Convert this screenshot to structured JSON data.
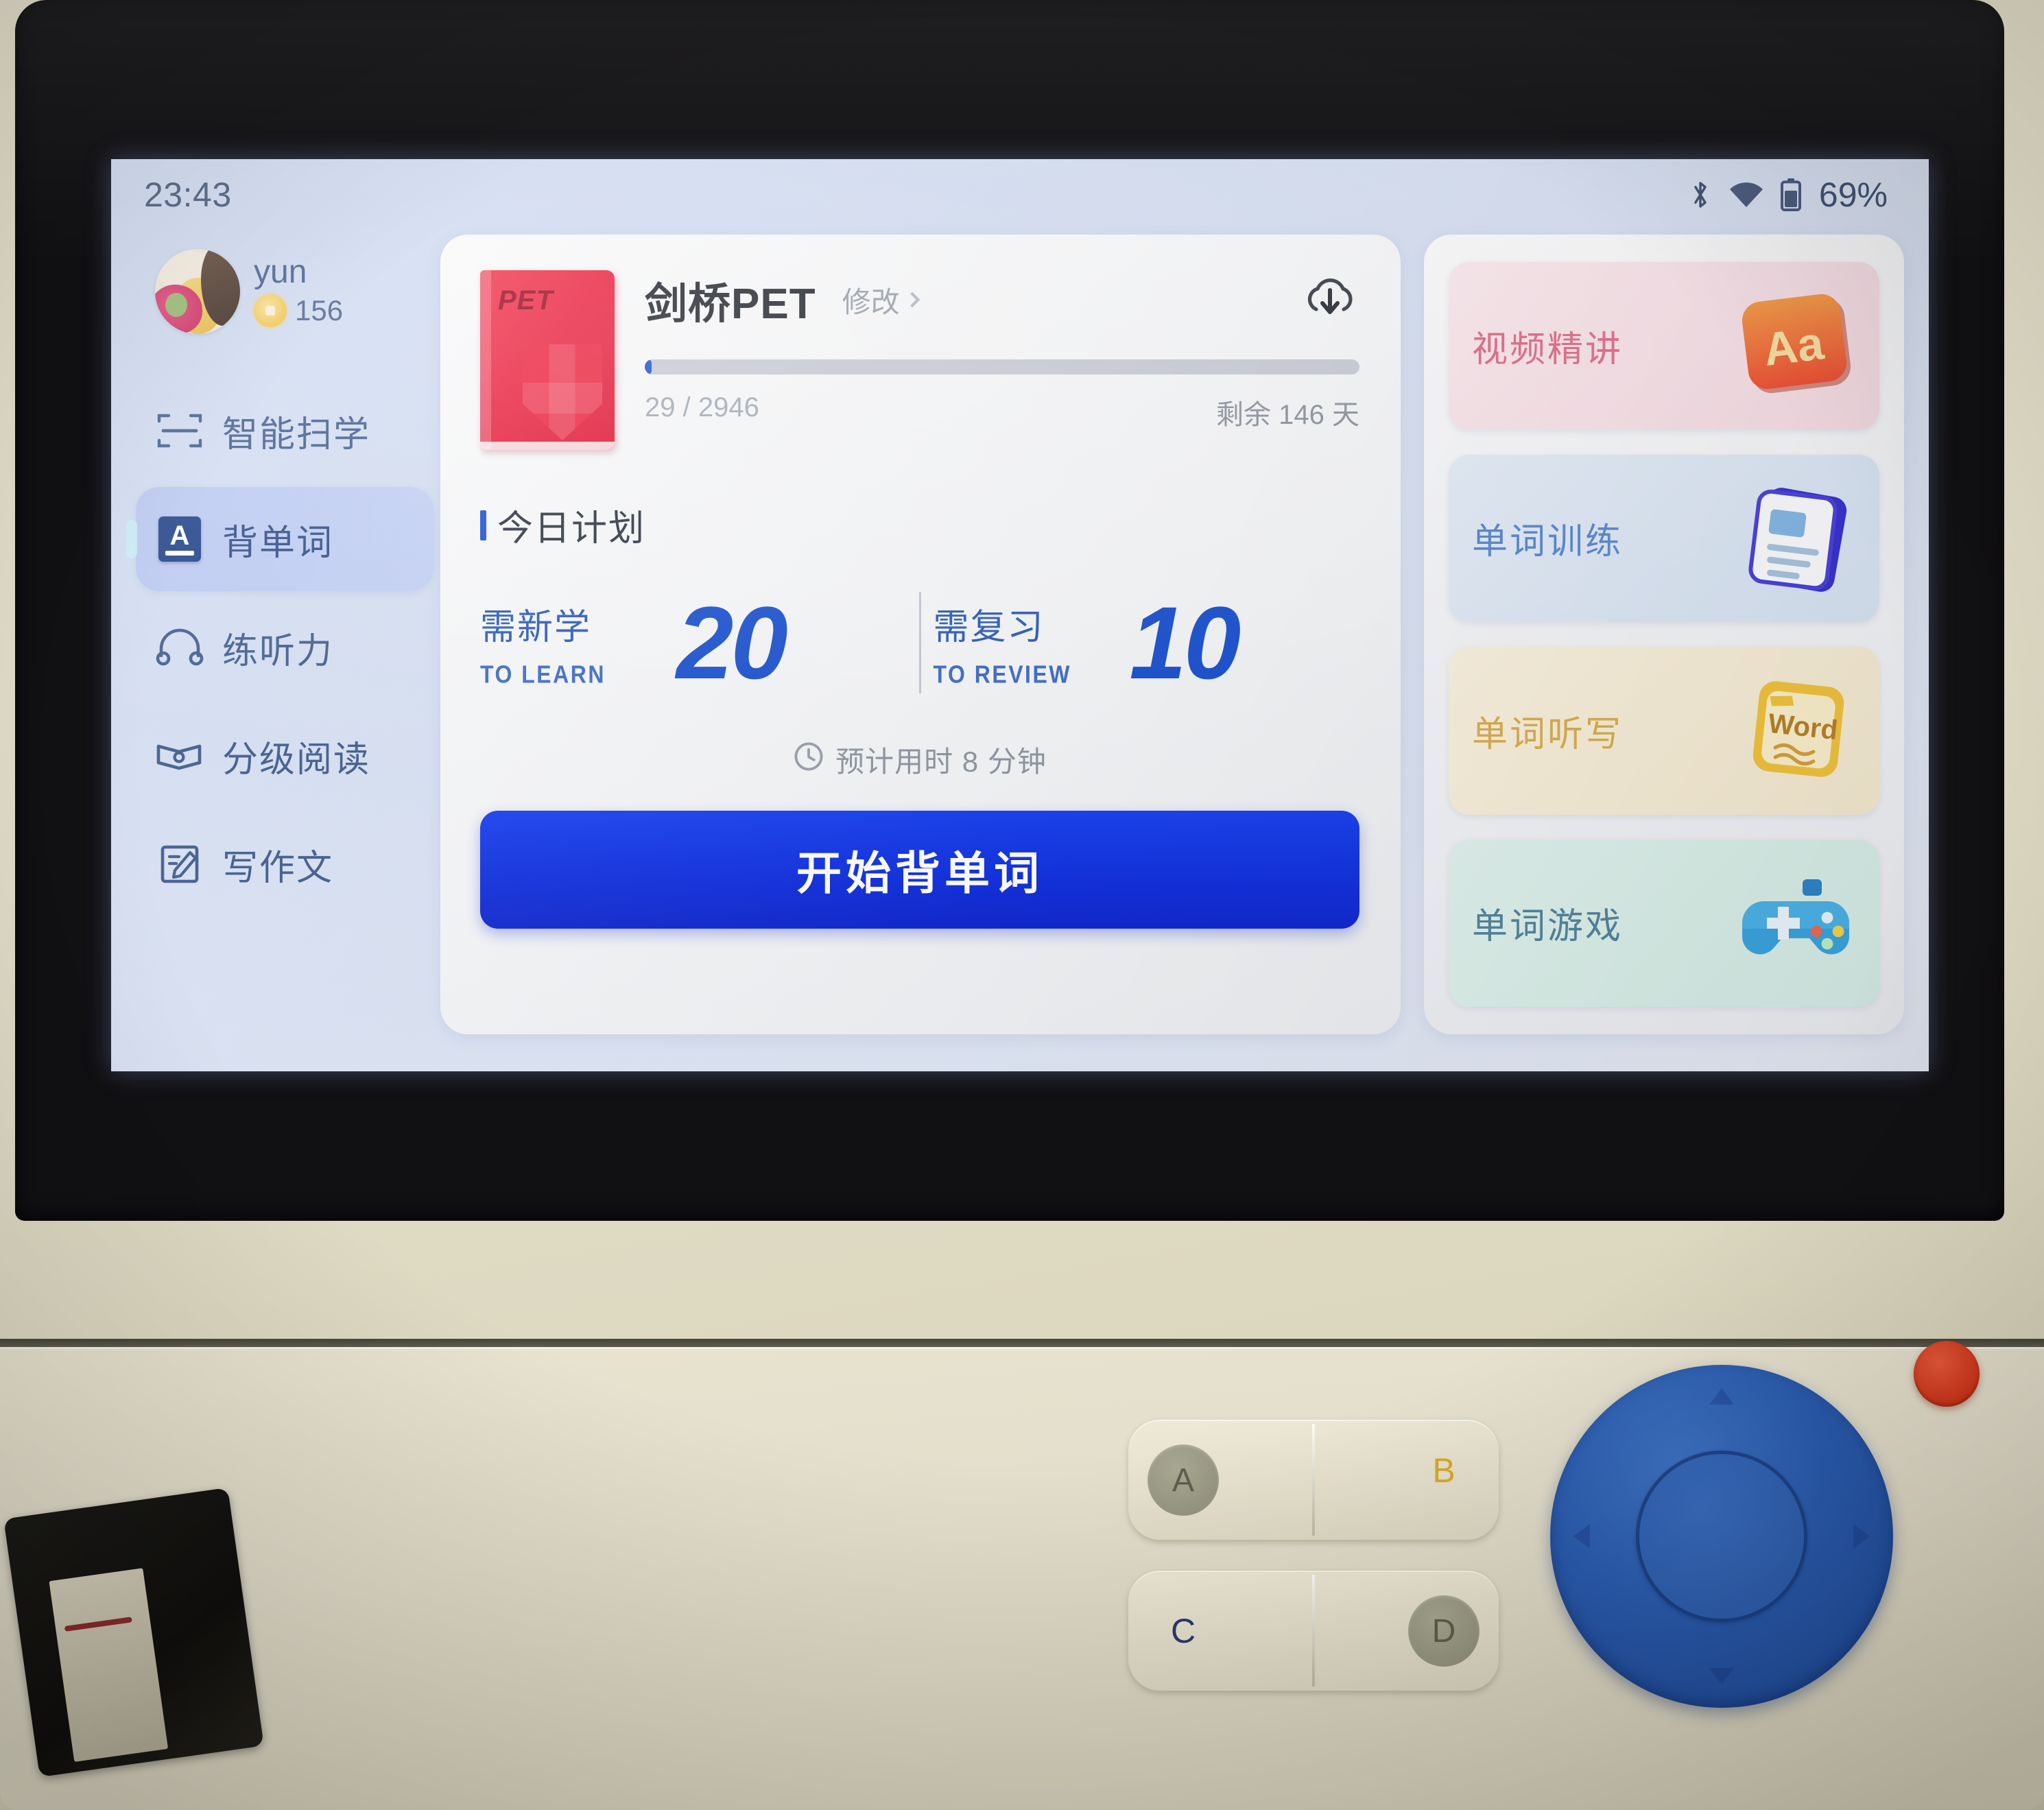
{
  "statusbar": {
    "time": "23:43",
    "battery_percent": "69%",
    "bluetooth_icon": "bluetooth-icon",
    "wifi_icon": "wifi-icon",
    "battery_icon": "battery-icon"
  },
  "sidebar": {
    "user": {
      "name": "yun",
      "coins": "156",
      "avatar_icon": "avatar-photo"
    },
    "items": [
      {
        "label": "智能扫学",
        "icon": "scan-icon",
        "active": false
      },
      {
        "label": "背单词",
        "icon": "vocabulary-book-icon",
        "icon_letter": "A",
        "active": true
      },
      {
        "label": "练听力",
        "icon": "headphones-icon",
        "active": false
      },
      {
        "label": "分级阅读",
        "icon": "open-book-icon",
        "active": false
      },
      {
        "label": "写作文",
        "icon": "write-document-icon",
        "active": false
      }
    ]
  },
  "main": {
    "book": {
      "cover_text": "PET",
      "title": "剑桥PET",
      "edit_label": "修改",
      "download_icon": "cloud-download-icon"
    },
    "progress": {
      "current": "29",
      "total": "2946",
      "count_text": "29 / 2946",
      "days_left_text": "剩余 146 天",
      "percent": 0.98
    },
    "plan": {
      "section_title": "今日计划",
      "to_learn": {
        "label_cn": "需新学",
        "label_en": "TO LEARN",
        "value": "20"
      },
      "to_review": {
        "label_cn": "需复习",
        "label_en": "TO REVIEW",
        "value": "10"
      },
      "eta_text": "预计用时 8 分钟",
      "eta_icon": "clock-icon"
    },
    "start_button": "开始背单词"
  },
  "right_panel": {
    "cards": [
      {
        "label": "视频精讲",
        "icon": "aa-letters-icon",
        "accent": "#d97089"
      },
      {
        "label": "单词训练",
        "icon": "flashcard-icon",
        "accent": "#5b86c8"
      },
      {
        "label": "单词听写",
        "icon": "word-notebook-icon",
        "accent": "#cfa74f"
      },
      {
        "label": "单词游戏",
        "icon": "gamepad-icon",
        "accent": "#4f7f96"
      }
    ],
    "card_icon_texts": {
      "video": "Aa",
      "dictation": "Word"
    }
  },
  "hardware": {
    "keys": [
      {
        "label": "A",
        "style": "dot"
      },
      {
        "label": "B",
        "style": "amber"
      },
      {
        "label": "C",
        "style": "plain"
      },
      {
        "label": "D",
        "style": "dot"
      }
    ],
    "dpad_icon": "dpad-control",
    "power_icon": "red-power-button",
    "scanner_icon": "scanner-slot"
  },
  "colors": {
    "primary_blue": "#1a4fd6",
    "title_dark": "#23272e",
    "screen_bg": "#d4def2",
    "book_red": "#ec2240"
  }
}
